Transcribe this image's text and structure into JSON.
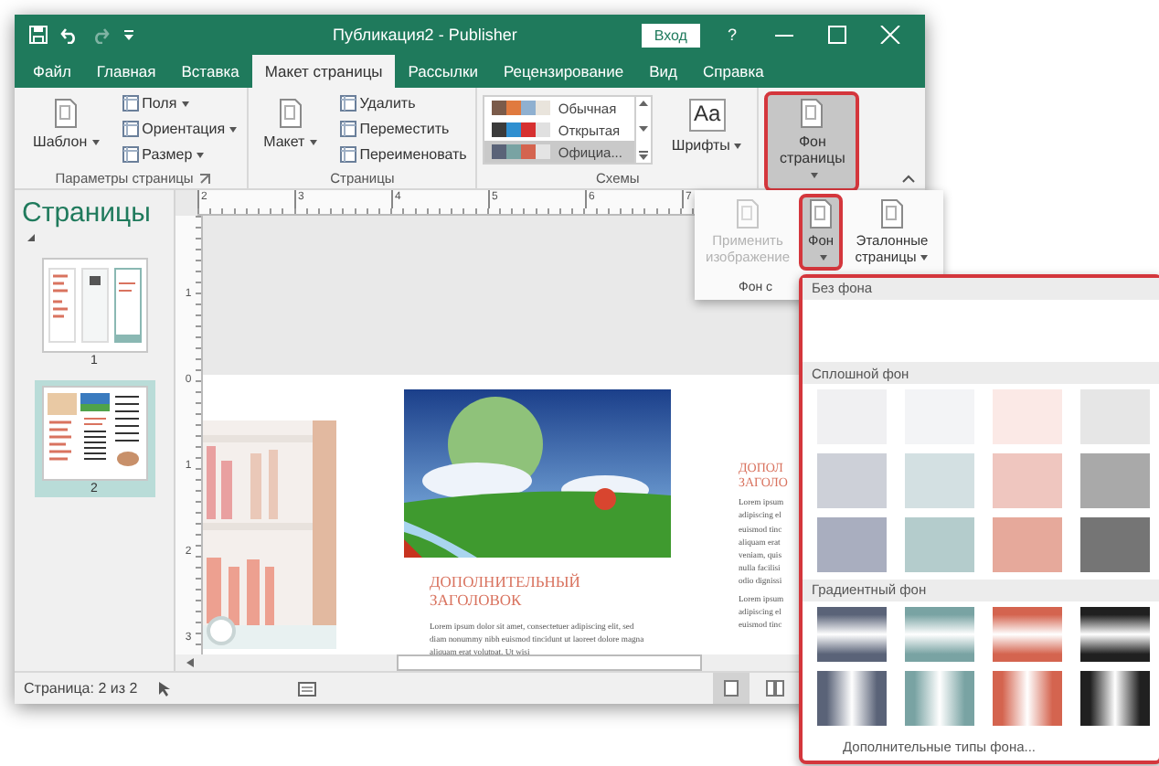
{
  "window": {
    "title": "Публикация2 - Publisher",
    "sign_in": "Вход",
    "help": "?"
  },
  "tabs": [
    {
      "label": "Файл",
      "selected": false
    },
    {
      "label": "Главная",
      "selected": false
    },
    {
      "label": "Вставка",
      "selected": false
    },
    {
      "label": "Макет страницы",
      "selected": true
    },
    {
      "label": "Рассылки",
      "selected": false
    },
    {
      "label": "Рецензирование",
      "selected": false
    },
    {
      "label": "Вид",
      "selected": false
    },
    {
      "label": "Справка",
      "selected": false
    }
  ],
  "ribbon": {
    "groups": [
      {
        "label": "Параметры страницы",
        "launcher": true,
        "items": [
          {
            "kind": "large",
            "label": "Шаблон",
            "caret": true,
            "pressed": false,
            "highlighted": false
          },
          {
            "kind": "stack",
            "buttons": [
              {
                "label": "Поля",
                "caret": true
              },
              {
                "label": "Ориентация",
                "caret": true
              },
              {
                "label": "Размер",
                "caret": true
              }
            ]
          }
        ]
      },
      {
        "label": "Страницы",
        "launcher": false,
        "items": [
          {
            "kind": "large",
            "label": "Макет",
            "caret": true,
            "pressed": false,
            "highlighted": false
          },
          {
            "kind": "stack",
            "buttons": [
              {
                "label": "Удалить",
                "caret": false
              },
              {
                "label": "Переместить",
                "caret": false
              },
              {
                "label": "Переименовать",
                "caret": false
              }
            ]
          }
        ]
      },
      {
        "label": "Схемы",
        "launcher": false,
        "items": [
          {
            "kind": "schemes",
            "rows": [
              {
                "label": "Обычная",
                "selected": false,
                "colors": [
                  {
                    "color": "#7b5b4a"
                  },
                  {
                    "color": "#e07a3f"
                  },
                  {
                    "color": "#8fb0d0"
                  },
                  {
                    "color": "#e9e4dc"
                  }
                ]
              },
              {
                "label": "Открытая",
                "selected": false,
                "colors": [
                  {
                    "color": "#3b3b3b"
                  },
                  {
                    "color": "#2f8fd0"
                  },
                  {
                    "color": "#d63030"
                  },
                  {
                    "color": "#e0e0e0"
                  }
                ]
              },
              {
                "label": "Официа...",
                "selected": true,
                "colors": [
                  {
                    "color": "#5a6378"
                  },
                  {
                    "color": "#79a3a3"
                  },
                  {
                    "color": "#d4644f"
                  },
                  {
                    "color": "#e4e4e4"
                  }
                ]
              }
            ]
          },
          {
            "kind": "large",
            "label": "Шрифты",
            "glyph": "Aa",
            "caret": true,
            "pressed": false,
            "highlighted": false
          }
        ]
      },
      {
        "items": [
          {
            "kind": "large",
            "label": "Фон страницы",
            "caret": true,
            "pressed": true,
            "highlighted": true
          }
        ]
      }
    ]
  },
  "background_panel": {
    "group_label": "Фон с",
    "items": [
      {
        "label": "Применить изображение",
        "caret": false,
        "disabled": true,
        "pressed": false,
        "highlighted": false
      },
      {
        "label": "Фон",
        "caret": true,
        "disabled": false,
        "pressed": true,
        "highlighted": true
      },
      {
        "label": "Эталонные страницы",
        "caret": true,
        "disabled": false,
        "pressed": false,
        "highlighted": false
      }
    ]
  },
  "pages_pane": {
    "title": "Страницы",
    "pages": [
      {
        "number": "1",
        "selected": false
      },
      {
        "number": "2",
        "selected": true
      }
    ]
  },
  "ruler": {
    "horizontal": [
      "2",
      "3",
      "4",
      "5",
      "6",
      "7"
    ],
    "vertical": [
      "1",
      "0",
      "1",
      "2",
      "3"
    ]
  },
  "document": {
    "heading": "ДОПОЛНИТЕЛЬНЫЙ ЗАГОЛОВОК",
    "body": "Lorem ipsum dolor sit amet, consectetuer adipiscing elit, sed diam nonummy nibh euismod tincidunt ut laoreet dolore magna aliquam erat volutpat. Ut wisi",
    "right_heading": [
      "ДОПОЛ",
      "ЗАГОЛО"
    ],
    "right_paragraphs": [
      [
        "Lorem ipsum",
        "adipiscing el",
        "euismod tinc",
        "aliquam erat",
        "veniam, quis",
        "nulla facilisi",
        "odio dignissi"
      ],
      [
        "Lorem ipsum",
        "adipiscing el",
        "euismod tinc"
      ]
    ]
  },
  "status_bar": {
    "page_info": "Страница: 2 из 2",
    "views": [
      {
        "selected": true
      },
      {
        "selected": false
      }
    ]
  },
  "background_gallery": {
    "highlighted": true,
    "sections": [
      {
        "kind": "empty",
        "title": "Без фона"
      },
      {
        "kind": "solid",
        "title": "Сплошной фон",
        "swatches": [
          {
            "color": "#f0f0f2"
          },
          {
            "color": "#f3f4f6"
          },
          {
            "color": "#fbe9e6"
          },
          {
            "color": "#e6e6e6"
          },
          {
            "color": "#cdd0d8"
          },
          {
            "color": "#d3e0e2"
          },
          {
            "color": "#efc6bf"
          },
          {
            "color": "#a9a9a9"
          },
          {
            "color": "#a9aebf"
          },
          {
            "color": "#b4cccc"
          },
          {
            "color": "#e6a99b"
          },
          {
            "color": "#757575"
          }
        ]
      },
      {
        "kind": "gradient",
        "title": "Градиентный фон",
        "swatches": [
          {
            "kind": "horizontal",
            "color": "#5a6378"
          },
          {
            "kind": "horizontal",
            "color": "#79a3a3"
          },
          {
            "kind": "horizontal",
            "color": "#d4644f"
          },
          {
            "kind": "horizontal",
            "color": "#202020"
          },
          {
            "kind": "vertical",
            "color": "#5a6378"
          },
          {
            "kind": "vertical",
            "color": "#79a3a3"
          },
          {
            "kind": "vertical",
            "color": "#d4644f"
          },
          {
            "kind": "vertical",
            "color": "#202020"
          }
        ]
      }
    ],
    "more_link": "Дополнительные типы фона..."
  }
}
